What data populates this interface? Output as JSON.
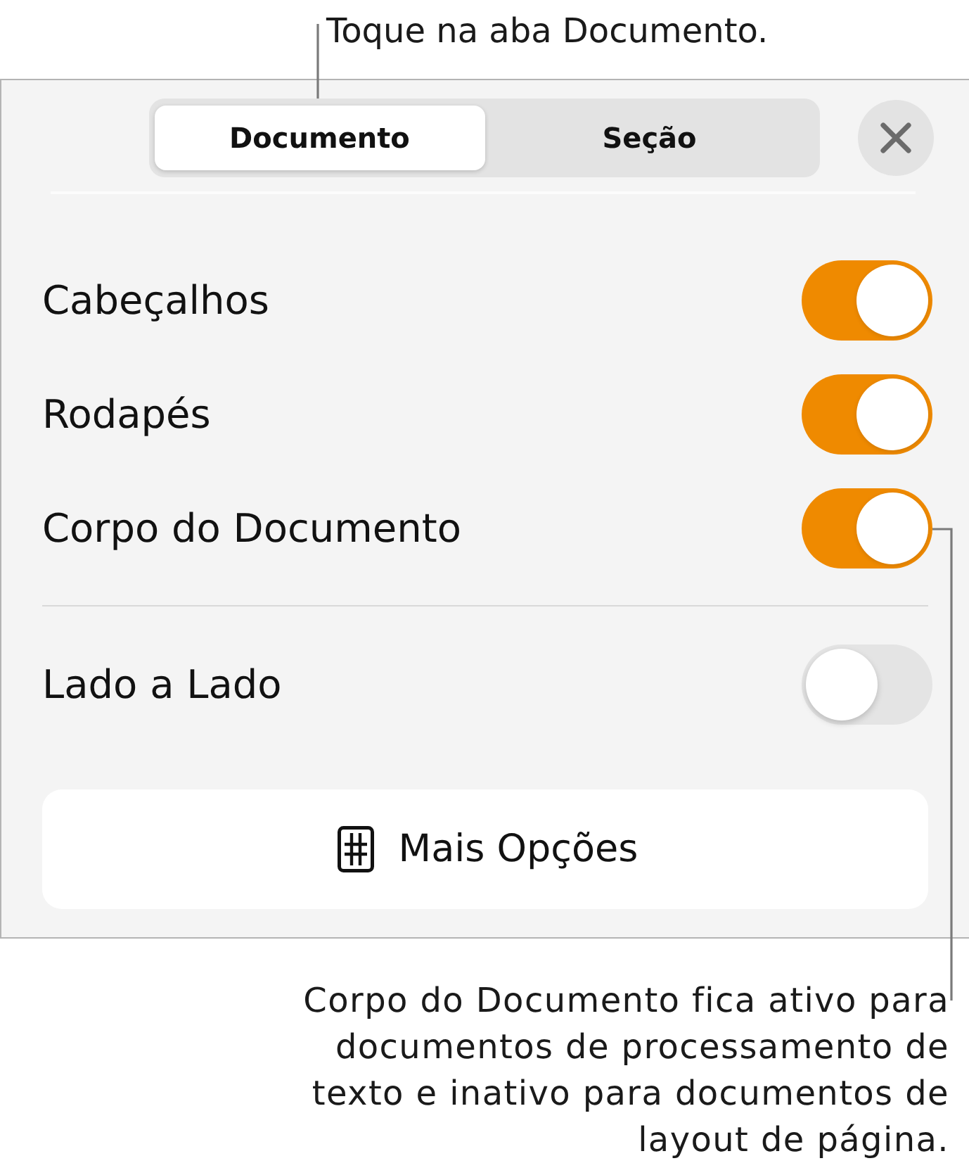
{
  "top_callout": {
    "text": "Toque na aba Documento."
  },
  "panel": {
    "tabs": [
      {
        "label": "Documento",
        "selected": true
      },
      {
        "label": "Seção",
        "selected": false
      }
    ],
    "setting_groups": [
      {
        "settings": [
          {
            "label": "Cabeçalhos",
            "on": true
          },
          {
            "label": "Rodapés",
            "on": true
          },
          {
            "label": "Corpo do Documento",
            "on": true
          }
        ]
      },
      {
        "settings": [
          {
            "label": "Lado a Lado",
            "on": false
          }
        ]
      }
    ],
    "more_options_button": {
      "label": "Mais Opções"
    }
  },
  "bottom_callout": {
    "text": "Corpo do Documento fica ativo para documentos de processamento de texto e inativo para documentos de layout de página."
  }
}
